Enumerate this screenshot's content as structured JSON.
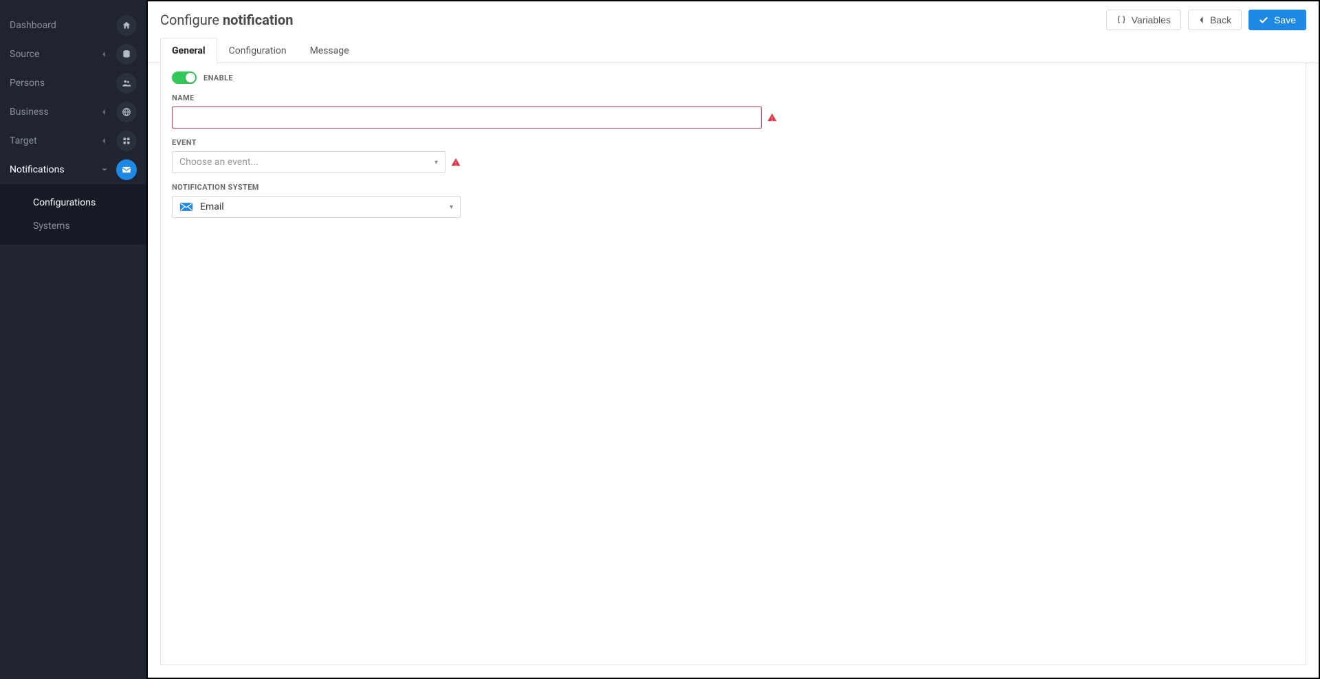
{
  "sidebar": {
    "items": [
      {
        "label": "Dashboard",
        "icon": "home"
      },
      {
        "label": "Source",
        "icon": "database",
        "expandable": true
      },
      {
        "label": "Persons",
        "icon": "users"
      },
      {
        "label": "Business",
        "icon": "globe",
        "expandable": true
      },
      {
        "label": "Target",
        "icon": "grid",
        "expandable": true
      },
      {
        "label": "Notifications",
        "icon": "mail",
        "expandable": true,
        "active": true,
        "expanded": true
      }
    ],
    "submenu": [
      {
        "label": "Configurations",
        "active": true
      },
      {
        "label": "Systems"
      }
    ]
  },
  "header": {
    "title_prefix": "Configure ",
    "title_bold": "notification",
    "buttons": {
      "variables": "Variables",
      "back": "Back",
      "save": "Save"
    }
  },
  "tabs": [
    {
      "label": "General",
      "active": true
    },
    {
      "label": "Configuration"
    },
    {
      "label": "Message"
    }
  ],
  "form": {
    "enable_label": "ENABLE",
    "enable_value": true,
    "name_label": "NAME",
    "name_value": "",
    "name_error": true,
    "event_label": "EVENT",
    "event_placeholder": "Choose an event...",
    "event_error": true,
    "system_label": "NOTIFICATION SYSTEM",
    "system_value": "Email"
  }
}
